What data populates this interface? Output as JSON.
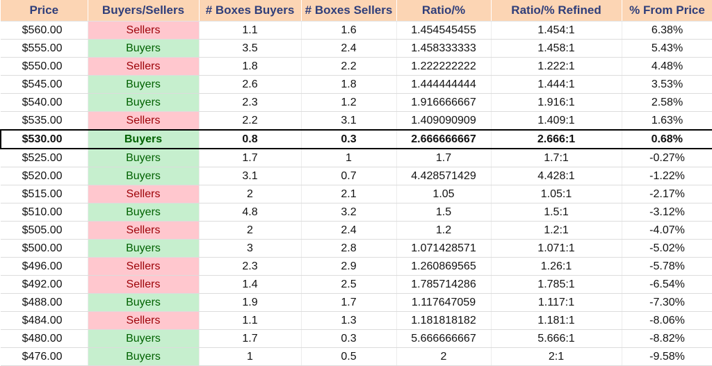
{
  "headers": [
    "Price",
    "Buyers/Sellers",
    "# Boxes Buyers",
    "# Boxes Sellers",
    "Ratio/%",
    "Ratio/% Refined",
    "% From Price"
  ],
  "colors": {
    "header_bg": "#fcd5b4",
    "header_text": "#2f3e7a",
    "buyers_bg": "#c6efce",
    "buyers_text": "#006100",
    "sellers_bg": "#ffc7ce",
    "sellers_text": "#9c0006"
  },
  "current_price_row": 6,
  "rows": [
    {
      "price": "$560.00",
      "side": "Sellers",
      "boxes_buyers": "1.1",
      "boxes_sellers": "1.6",
      "ratio": "1.454545455",
      "ratio_refined": "1.454:1",
      "pct_from_price": "6.38%"
    },
    {
      "price": "$555.00",
      "side": "Buyers",
      "boxes_buyers": "3.5",
      "boxes_sellers": "2.4",
      "ratio": "1.458333333",
      "ratio_refined": "1.458:1",
      "pct_from_price": "5.43%"
    },
    {
      "price": "$550.00",
      "side": "Sellers",
      "boxes_buyers": "1.8",
      "boxes_sellers": "2.2",
      "ratio": "1.222222222",
      "ratio_refined": "1.222:1",
      "pct_from_price": "4.48%"
    },
    {
      "price": "$545.00",
      "side": "Buyers",
      "boxes_buyers": "2.6",
      "boxes_sellers": "1.8",
      "ratio": "1.444444444",
      "ratio_refined": "1.444:1",
      "pct_from_price": "3.53%"
    },
    {
      "price": "$540.00",
      "side": "Buyers",
      "boxes_buyers": "2.3",
      "boxes_sellers": "1.2",
      "ratio": "1.916666667",
      "ratio_refined": "1.916:1",
      "pct_from_price": "2.58%"
    },
    {
      "price": "$535.00",
      "side": "Sellers",
      "boxes_buyers": "2.2",
      "boxes_sellers": "3.1",
      "ratio": "1.409090909",
      "ratio_refined": "1.409:1",
      "pct_from_price": "1.63%"
    },
    {
      "price": "$530.00",
      "side": "Buyers",
      "boxes_buyers": "0.8",
      "boxes_sellers": "0.3",
      "ratio": "2.666666667",
      "ratio_refined": "2.666:1",
      "pct_from_price": "0.68%"
    },
    {
      "price": "$525.00",
      "side": "Buyers",
      "boxes_buyers": "1.7",
      "boxes_sellers": "1",
      "ratio": "1.7",
      "ratio_refined": "1.7:1",
      "pct_from_price": "-0.27%"
    },
    {
      "price": "$520.00",
      "side": "Buyers",
      "boxes_buyers": "3.1",
      "boxes_sellers": "0.7",
      "ratio": "4.428571429",
      "ratio_refined": "4.428:1",
      "pct_from_price": "-1.22%"
    },
    {
      "price": "$515.00",
      "side": "Sellers",
      "boxes_buyers": "2",
      "boxes_sellers": "2.1",
      "ratio": "1.05",
      "ratio_refined": "1.05:1",
      "pct_from_price": "-2.17%"
    },
    {
      "price": "$510.00",
      "side": "Buyers",
      "boxes_buyers": "4.8",
      "boxes_sellers": "3.2",
      "ratio": "1.5",
      "ratio_refined": "1.5:1",
      "pct_from_price": "-3.12%"
    },
    {
      "price": "$505.00",
      "side": "Sellers",
      "boxes_buyers": "2",
      "boxes_sellers": "2.4",
      "ratio": "1.2",
      "ratio_refined": "1.2:1",
      "pct_from_price": "-4.07%"
    },
    {
      "price": "$500.00",
      "side": "Buyers",
      "boxes_buyers": "3",
      "boxes_sellers": "2.8",
      "ratio": "1.071428571",
      "ratio_refined": "1.071:1",
      "pct_from_price": "-5.02%"
    },
    {
      "price": "$496.00",
      "side": "Sellers",
      "boxes_buyers": "2.3",
      "boxes_sellers": "2.9",
      "ratio": "1.260869565",
      "ratio_refined": "1.26:1",
      "pct_from_price": "-5.78%"
    },
    {
      "price": "$492.00",
      "side": "Sellers",
      "boxes_buyers": "1.4",
      "boxes_sellers": "2.5",
      "ratio": "1.785714286",
      "ratio_refined": "1.785:1",
      "pct_from_price": "-6.54%"
    },
    {
      "price": "$488.00",
      "side": "Buyers",
      "boxes_buyers": "1.9",
      "boxes_sellers": "1.7",
      "ratio": "1.117647059",
      "ratio_refined": "1.117:1",
      "pct_from_price": "-7.30%"
    },
    {
      "price": "$484.00",
      "side": "Sellers",
      "boxes_buyers": "1.1",
      "boxes_sellers": "1.3",
      "ratio": "1.181818182",
      "ratio_refined": "1.181:1",
      "pct_from_price": "-8.06%"
    },
    {
      "price": "$480.00",
      "side": "Buyers",
      "boxes_buyers": "1.7",
      "boxes_sellers": "0.3",
      "ratio": "5.666666667",
      "ratio_refined": "5.666:1",
      "pct_from_price": "-8.82%"
    },
    {
      "price": "$476.00",
      "side": "Buyers",
      "boxes_buyers": "1",
      "boxes_sellers": "0.5",
      "ratio": "2",
      "ratio_refined": "2:1",
      "pct_from_price": "-9.58%"
    }
  ]
}
